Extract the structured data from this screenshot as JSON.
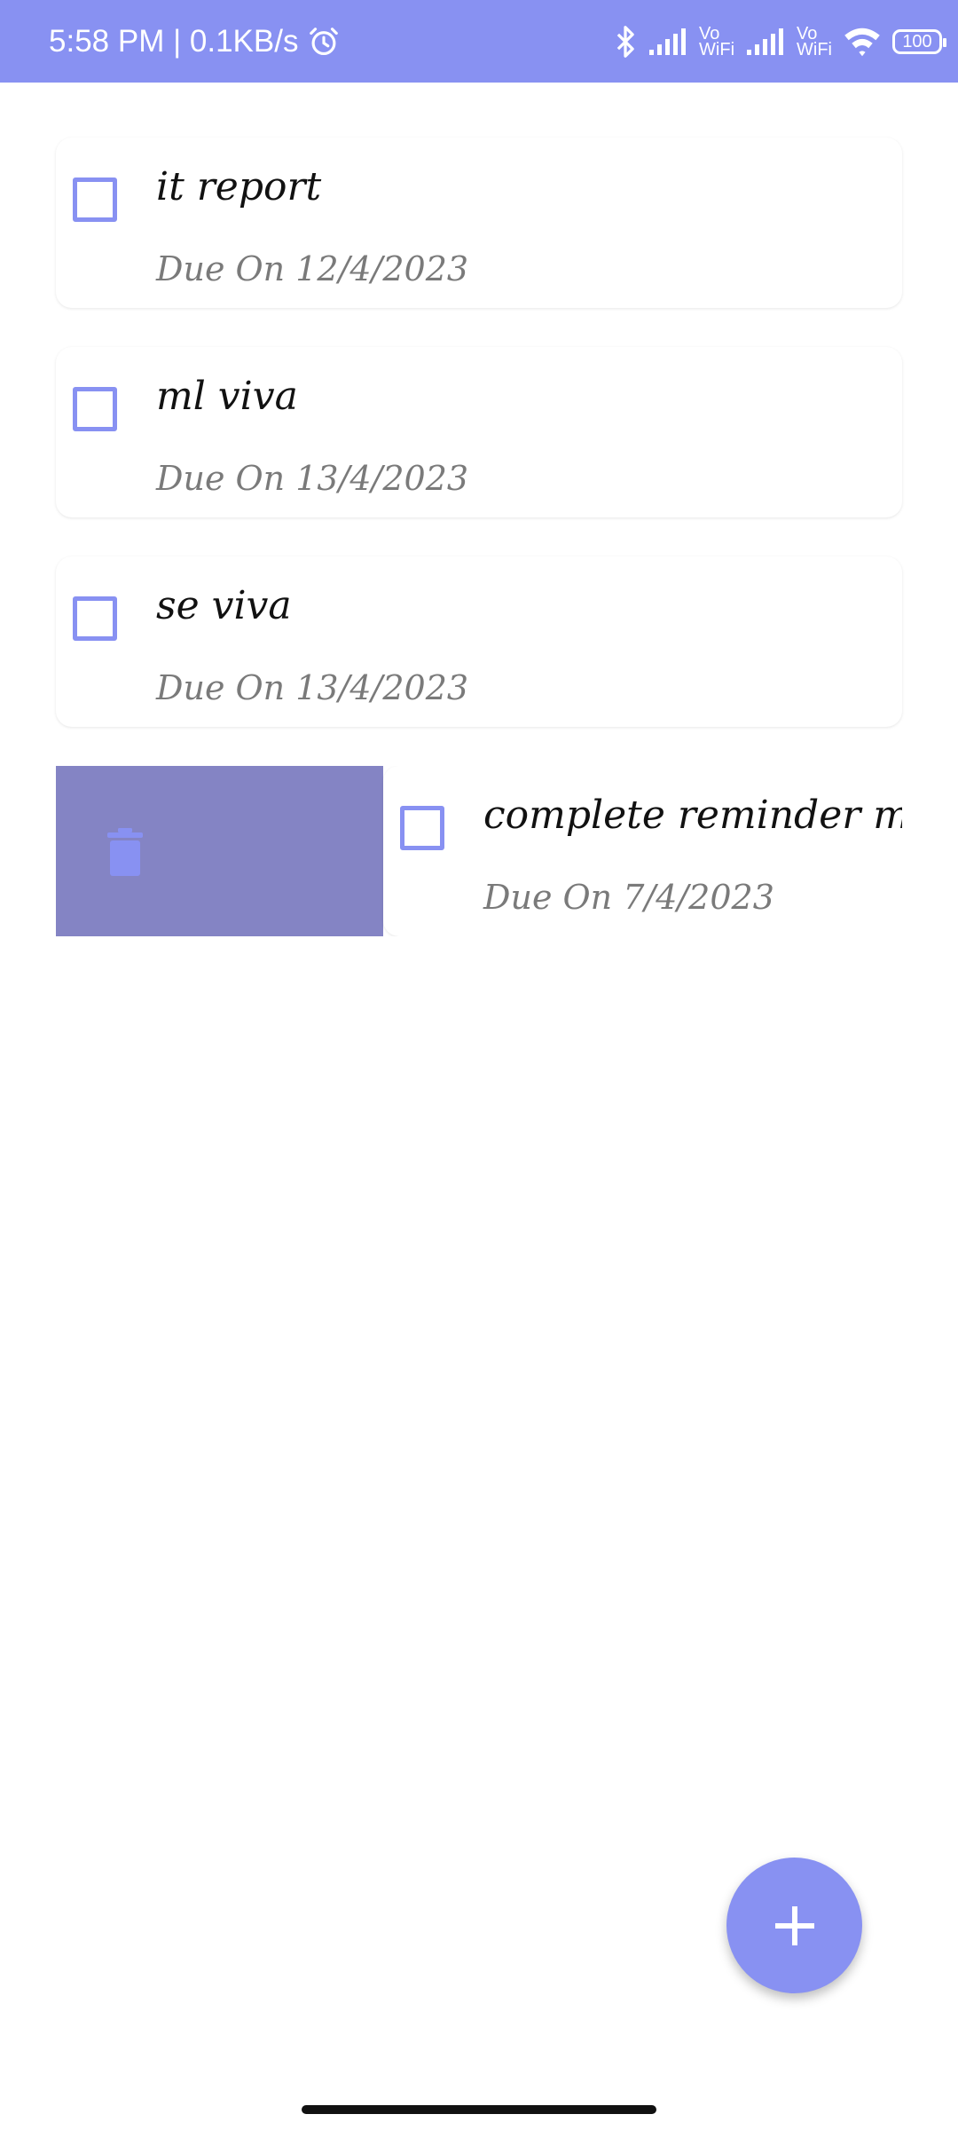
{
  "status_bar": {
    "time_speed": "5:58 PM | 0.1KB/s",
    "vo_1": "Vo",
    "wifi_1": "WiFi",
    "vo_2": "Vo",
    "wifi_2": "WiFi",
    "battery": "100",
    "icons": [
      "alarm-icon",
      "bluetooth-icon",
      "signal-icon",
      "wifi-icon",
      "battery-icon"
    ]
  },
  "tasks": [
    {
      "title": "it report",
      "due": "Due On 12/4/2023",
      "checked": false
    },
    {
      "title": "ml viva",
      "due": "Due On 13/4/2023",
      "checked": false
    },
    {
      "title": "se viva",
      "due": "Due On 13/4/2023",
      "checked": false
    },
    {
      "title": "complete reminder module by",
      "due": "Due On 7/4/2023",
      "checked": false
    }
  ],
  "swipe_action": {
    "icon": "trash-icon"
  },
  "fab": {
    "icon": "plus-icon"
  },
  "colors": {
    "accent": "#8891f2",
    "delete_bg": "#8484c4",
    "title_text": "#111111",
    "due_text": "#7a7a7a"
  }
}
